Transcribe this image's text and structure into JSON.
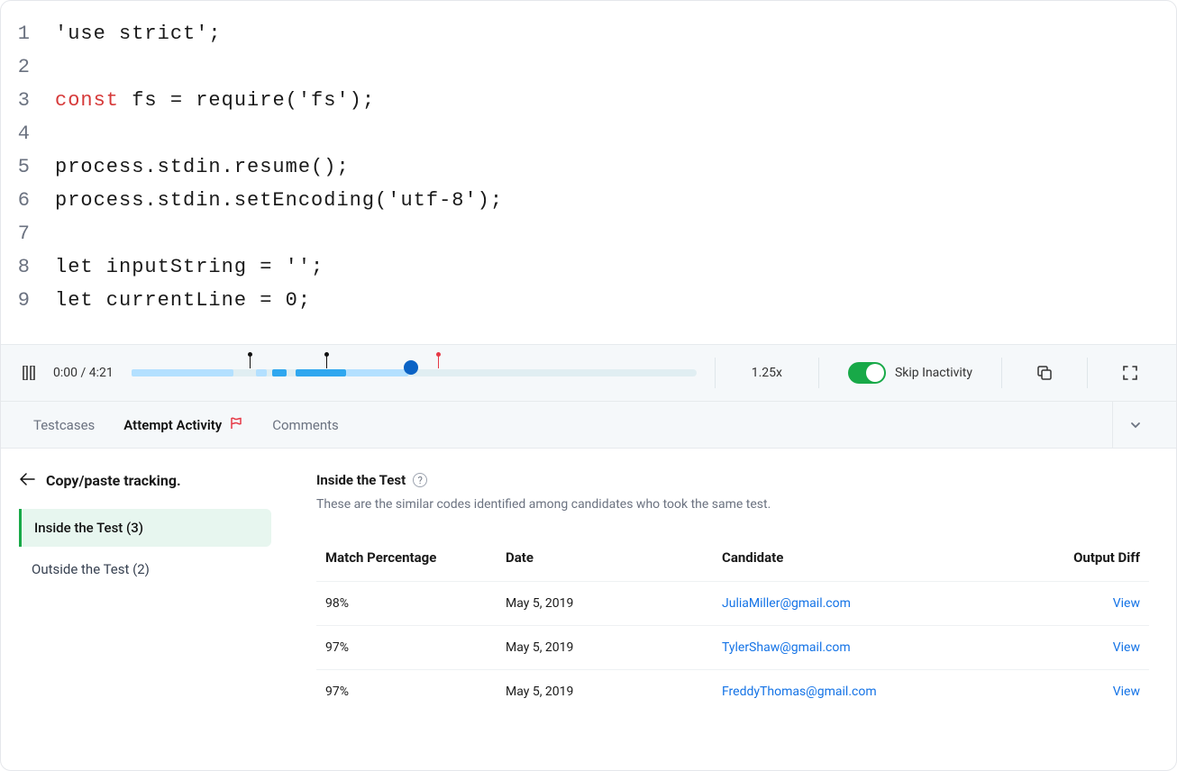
{
  "code_lines": [
    {
      "n": "1",
      "plain": "'use strict';"
    },
    {
      "n": "2",
      "plain": ""
    },
    {
      "n": "3",
      "const_kw": "const",
      "rest": " fs = require('fs');"
    },
    {
      "n": "4",
      "plain": ""
    },
    {
      "n": "5",
      "plain": "process.stdin.resume();"
    },
    {
      "n": "6",
      "plain": "process.stdin.setEncoding('utf-8');"
    },
    {
      "n": "7",
      "plain": ""
    },
    {
      "n": "8",
      "plain": "let inputString = '';"
    },
    {
      "n": "9",
      "plain": "let currentLine = 0;"
    }
  ],
  "player": {
    "time": "0:00 / 4:21",
    "speed": "1.25x",
    "toggle_label": "Skip Inactivity"
  },
  "tabs": {
    "testcases": "Testcases",
    "attempt": "Attempt Activity",
    "comments": "Comments"
  },
  "back_title": "Copy/paste tracking.",
  "side": {
    "inside": "Inside the Test (3)",
    "outside": "Outside the Test (2)"
  },
  "section": {
    "title": "Inside the Test",
    "desc": "These are the similar codes identified among candidates who took the same test."
  },
  "table": {
    "headers": {
      "match": "Match Percentage",
      "date": "Date",
      "candidate": "Candidate",
      "diff": "Output Diff"
    },
    "rows": [
      {
        "match": "98%",
        "date": "May 5, 2019",
        "candidate": "JuliaMiller@gmail.com",
        "diff": "View"
      },
      {
        "match": "97%",
        "date": "May 5, 2019",
        "candidate": "TylerShaw@gmail.com",
        "diff": "View"
      },
      {
        "match": "97%",
        "date": "May 5, 2019",
        "candidate": "FreddyThomas@gmail.com",
        "diff": "View"
      }
    ]
  }
}
